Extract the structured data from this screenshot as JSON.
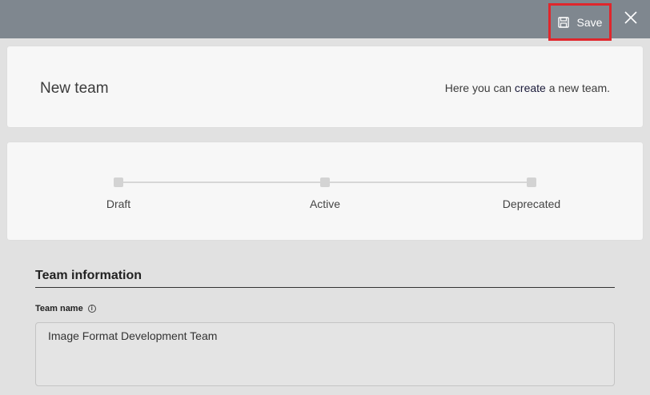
{
  "toolbar": {
    "save_label": "Save",
    "save_icon": "floppy-disk-icon",
    "close_icon": "close-icon"
  },
  "header": {
    "title": "New team",
    "description_prefix": "Here you can ",
    "description_highlight": "create",
    "description_suffix": " a new team."
  },
  "stages": [
    {
      "label": "Draft"
    },
    {
      "label": "Active"
    },
    {
      "label": "Deprecated"
    }
  ],
  "form": {
    "section_title": "Team information",
    "team_name_label": "Team name",
    "team_name_info_icon": "info-icon",
    "team_name_value": "Image Format Development Team"
  },
  "colors": {
    "topbar": "#7f878f",
    "save_highlight": "#e0262c"
  }
}
